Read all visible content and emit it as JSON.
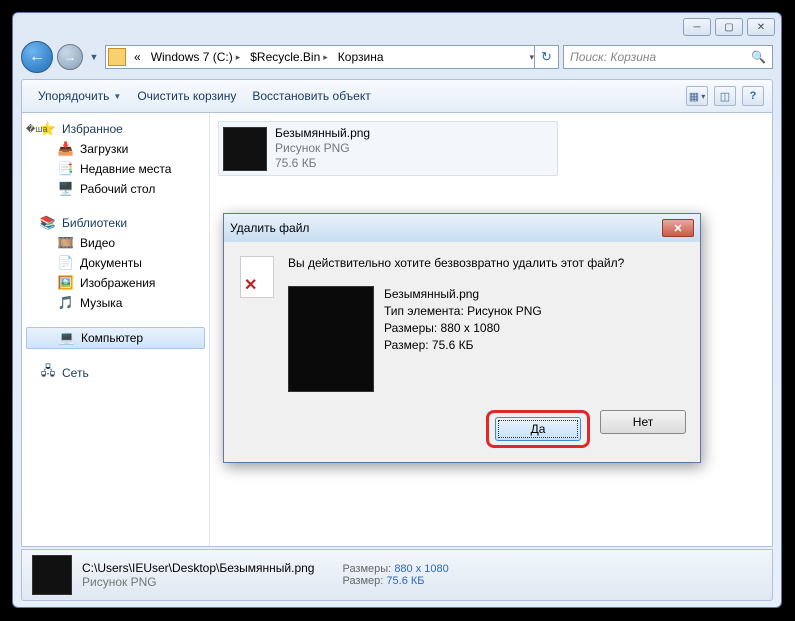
{
  "breadcrumb": {
    "chevron": "«",
    "seg1": "Windows 7 (C:)",
    "seg2": "$Recycle.Bin",
    "seg3": "Корзина"
  },
  "search": {
    "placeholder": "Поиск: Корзина"
  },
  "toolbar": {
    "organize": "Упорядочить",
    "empty": "Очистить корзину",
    "restore": "Восстановить объект"
  },
  "sidebar": {
    "favorites": "Избранное",
    "downloads": "Загрузки",
    "recent": "Недавние места",
    "desktop": "Рабочий стол",
    "libraries": "Библиотеки",
    "videos": "Видео",
    "documents": "Документы",
    "pictures": "Изображения",
    "music": "Музыка",
    "computer": "Компьютер",
    "network": "Сеть"
  },
  "file": {
    "name": "Безымянный.png",
    "type": "Рисунок PNG",
    "size": "75.6 КБ"
  },
  "dialog": {
    "title": "Удалить файл",
    "message": "Вы действительно хотите безвозвратно удалить этот файл?",
    "filename": "Безымянный.png",
    "proptype": "Тип элемента: Рисунок PNG",
    "propdim": "Размеры: 880 x 1080",
    "propsize": "Размер: 75.6 КБ",
    "yes": "Да",
    "no": "Нет"
  },
  "status": {
    "path": "C:\\Users\\IEUser\\Desktop\\Безымянный.png",
    "type": "Рисунок PNG",
    "dimlabel": "Размеры:",
    "dimval": "880 x 1080",
    "sizelabel": "Размер:",
    "sizeval": "75.6 КБ"
  }
}
